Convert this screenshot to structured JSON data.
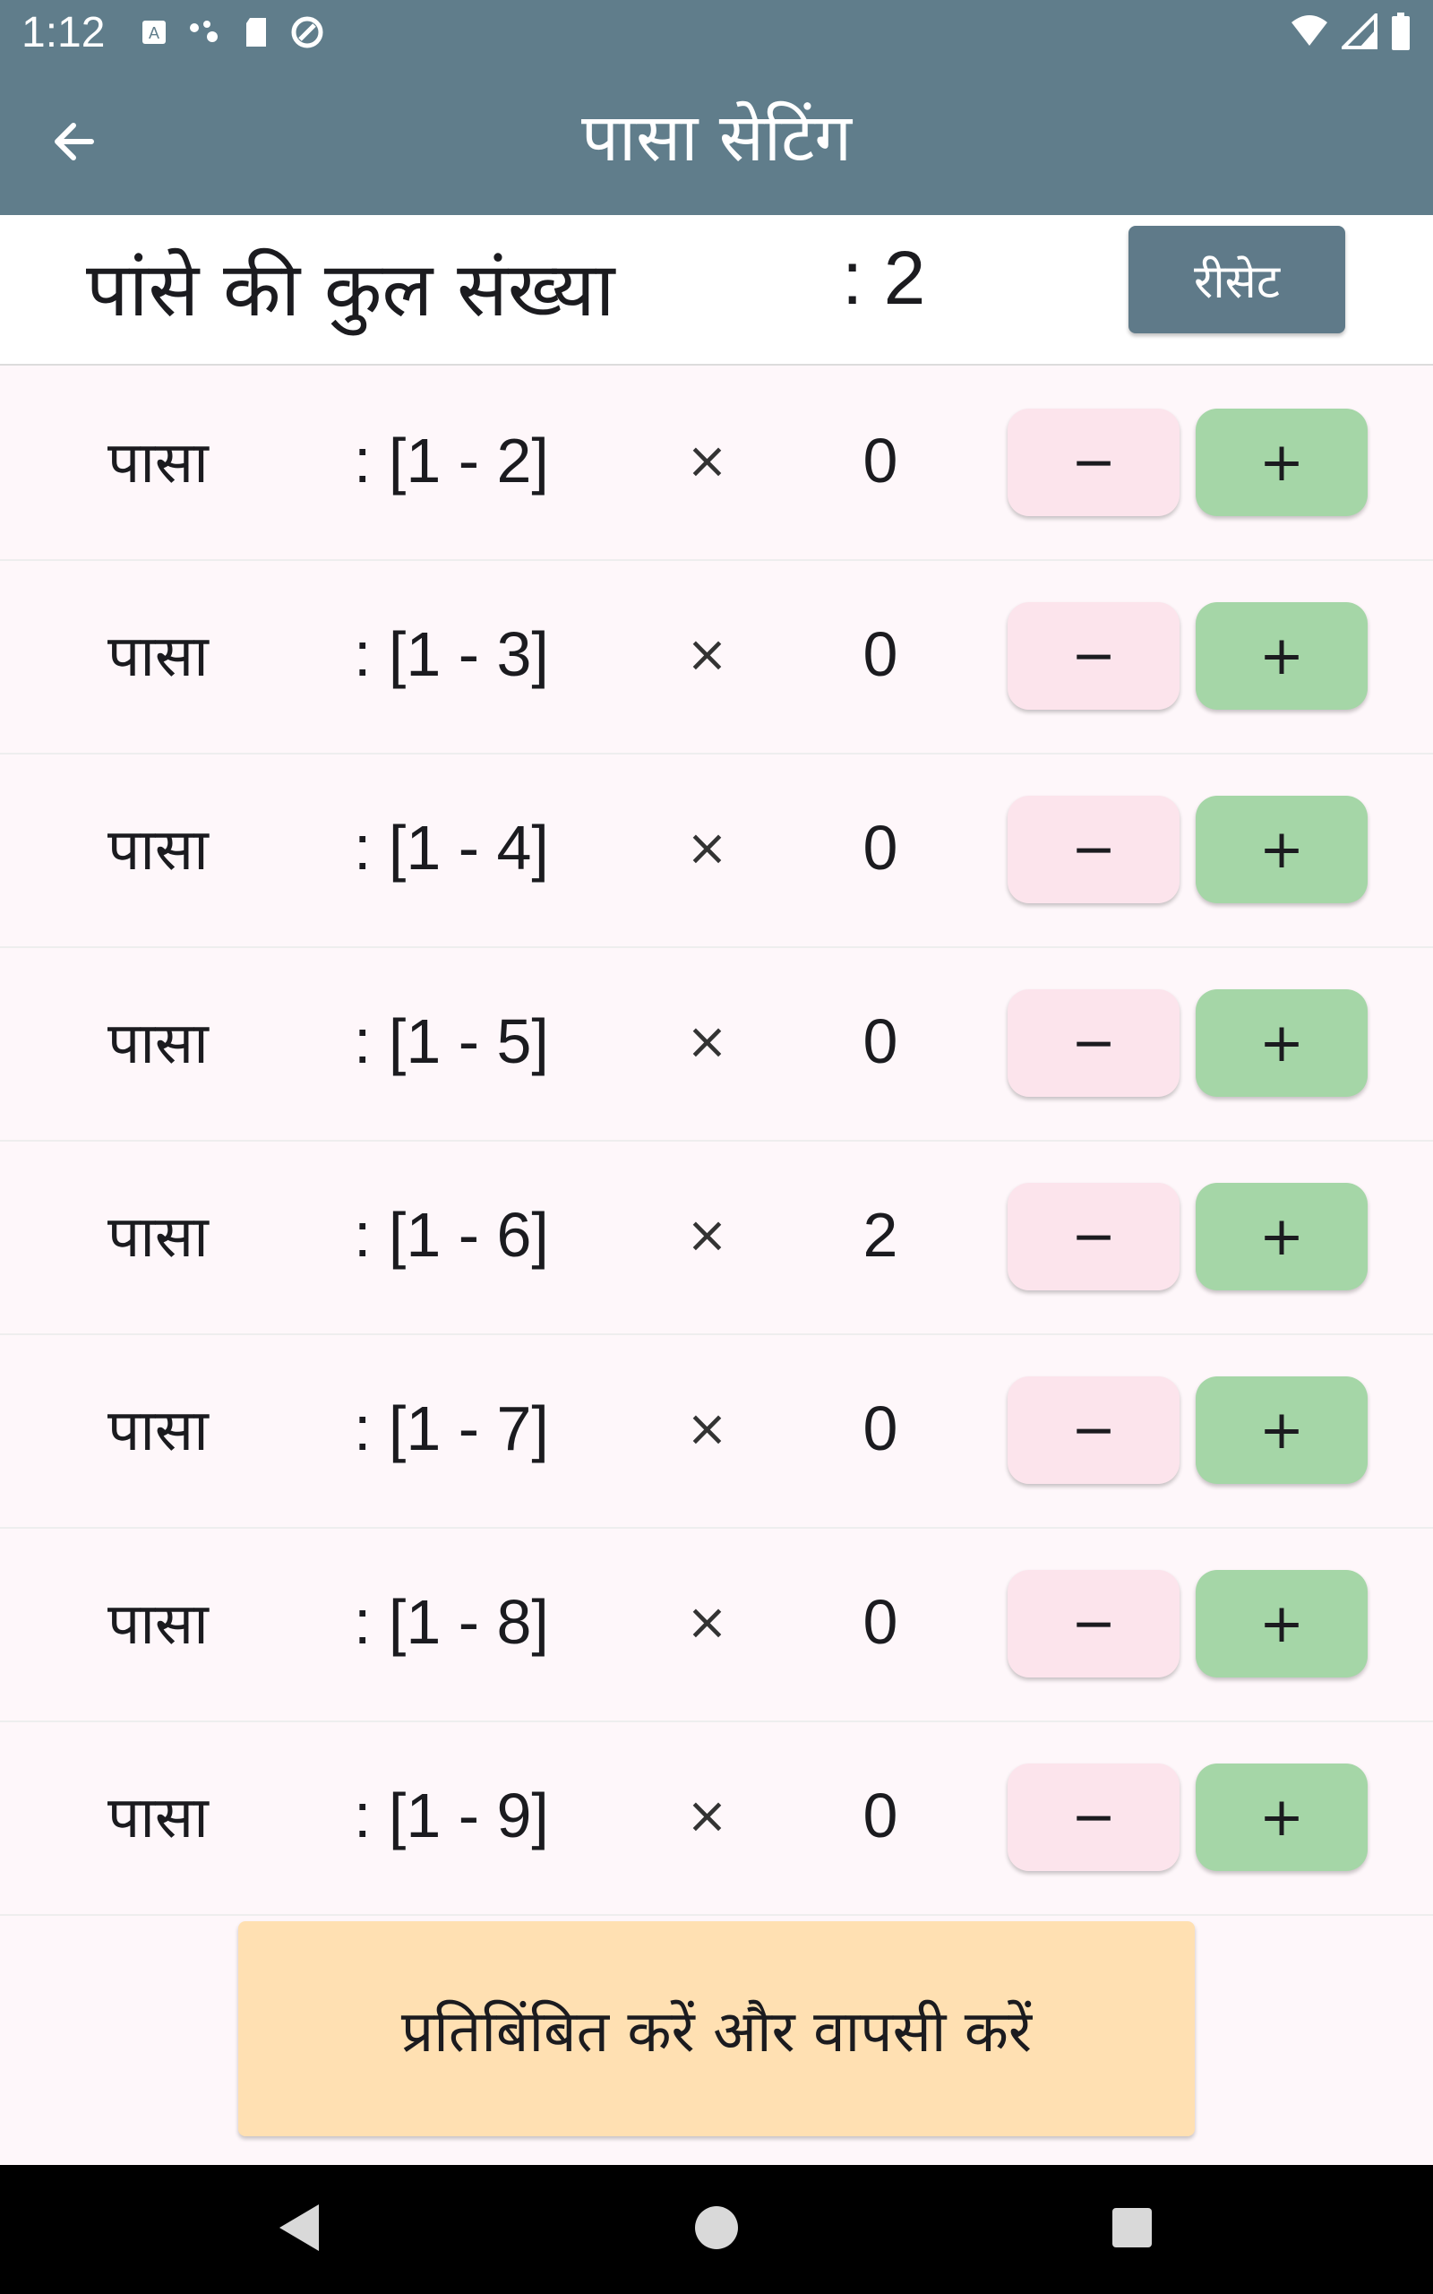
{
  "status_bar": {
    "time": "1:12",
    "left_icons": [
      "keyboard-a-icon",
      "dots-icon",
      "sd-card-icon",
      "sync-icon"
    ],
    "right_icons": [
      "wifi-icon",
      "signal-icon",
      "battery-icon"
    ]
  },
  "app_bar": {
    "title": "पासा सेटिंग",
    "back_icon": "arrow-back-icon"
  },
  "total": {
    "label": "पांसे की कुल संख्या",
    "value": ": 2",
    "reset_label": "रीसेट"
  },
  "dice_rows": [
    {
      "label": "पासा",
      "range": ": [1 - 2]",
      "times": "×",
      "count": "0",
      "minus": "−",
      "plus": "+"
    },
    {
      "label": "पासा",
      "range": ": [1 - 3]",
      "times": "×",
      "count": "0",
      "minus": "−",
      "plus": "+"
    },
    {
      "label": "पासा",
      "range": ": [1 - 4]",
      "times": "×",
      "count": "0",
      "minus": "−",
      "plus": "+"
    },
    {
      "label": "पासा",
      "range": ": [1 - 5]",
      "times": "×",
      "count": "0",
      "minus": "−",
      "plus": "+"
    },
    {
      "label": "पासा",
      "range": ": [1 - 6]",
      "times": "×",
      "count": "2",
      "minus": "−",
      "plus": "+"
    },
    {
      "label": "पासा",
      "range": ": [1 - 7]",
      "times": "×",
      "count": "0",
      "minus": "−",
      "plus": "+"
    },
    {
      "label": "पासा",
      "range": ": [1 - 8]",
      "times": "×",
      "count": "0",
      "minus": "−",
      "plus": "+"
    },
    {
      "label": "पासा",
      "range": ": [1 - 9]",
      "times": "×",
      "count": "0",
      "minus": "−",
      "plus": "+"
    }
  ],
  "confirm_label": "प्रतिबिंबित करें और वापसी करें",
  "colors": {
    "app_bar": "#607D8B",
    "minus_button": "#FCE4EC",
    "plus_button": "#A5D6A7",
    "confirm_button": "#FFE0B2"
  }
}
